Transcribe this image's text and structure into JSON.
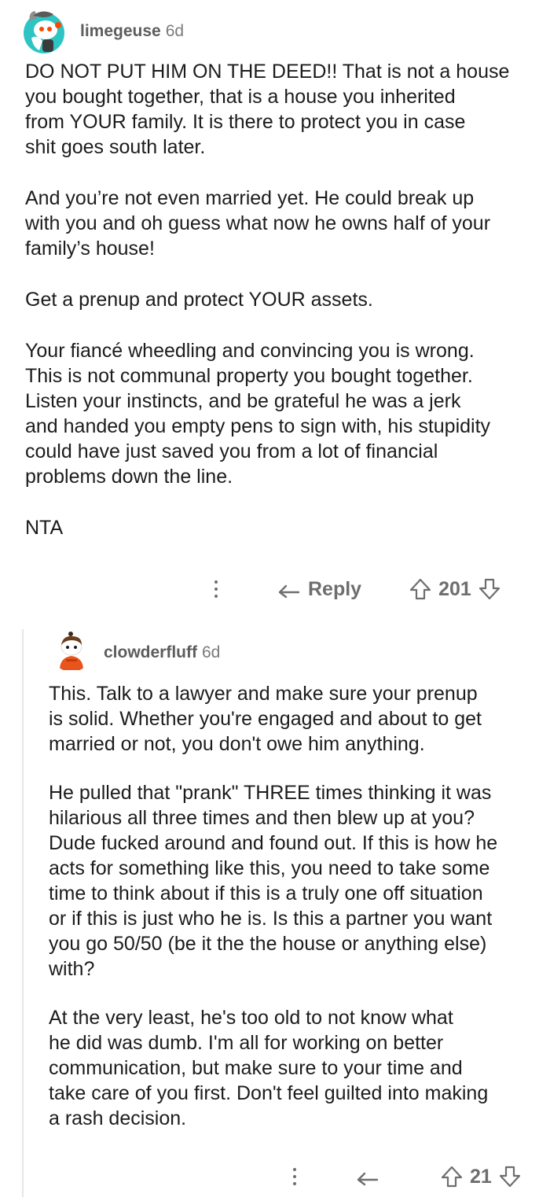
{
  "comments": [
    {
      "username": "limegeuse",
      "age": "6d",
      "paragraphs": [
        "DO NOT PUT HIM ON THE DEED!! That is not a house\nyou bought together, that is a house you inherited\nfrom YOUR family. It is there to protect you in case\nshit goes south later.",
        "And you’re not even married yet. He could break up\nwith you and oh guess what now he owns half of your\nfamily’s house!",
        "Get a prenup and protect YOUR assets.",
        "Your fiancé wheedling and convincing you is wrong.\nThis is not communal property you bought together.\nListen your instincts, and be grateful he was a jerk\nand handed you empty pens to sign with, his stupidity\ncould have just saved you from a lot of financial\nproblems down the line.",
        "NTA"
      ],
      "reply_label": "Reply",
      "score": "201"
    },
    {
      "username": "clowderfluff",
      "age": "6d",
      "paragraphs": [
        "This. Talk to a lawyer and make sure your prenup\nis solid. Whether you're engaged and about to get\nmarried or not, you don't owe him anything.",
        "He pulled that \"prank\" THREE times thinking it was\nhilarious all three times and then blew up at you?\nDude fucked around and found out. If this is how he\nacts for something like this, you need to take some\ntime to think about if this is a truly one off situation\nor if this is just who he is. Is this a partner you want\nyou go 50/50 (be it the the house or anything else)\nwith?",
        "At the very least, he's too old to not know what\nhe did was dumb. I'm all for working on better\ncommunication, but make sure to your time and\ntake care of you first. Don't feel guilted into making\na rash decision."
      ],
      "score": "21"
    }
  ],
  "icons": {
    "more": "more-vertical-icon",
    "reply": "reply-arrow-icon",
    "upvote": "upvote-arrow-icon",
    "downvote": "downvote-arrow-icon"
  },
  "colors": {
    "text": "#1c1c1c",
    "username": "#5d5d5d",
    "muted": "#6e6e6e",
    "thread_line": "#e6e6e6",
    "avatar1_bg": "#2ec4c4",
    "avatar2_shirt": "#e8541c"
  }
}
